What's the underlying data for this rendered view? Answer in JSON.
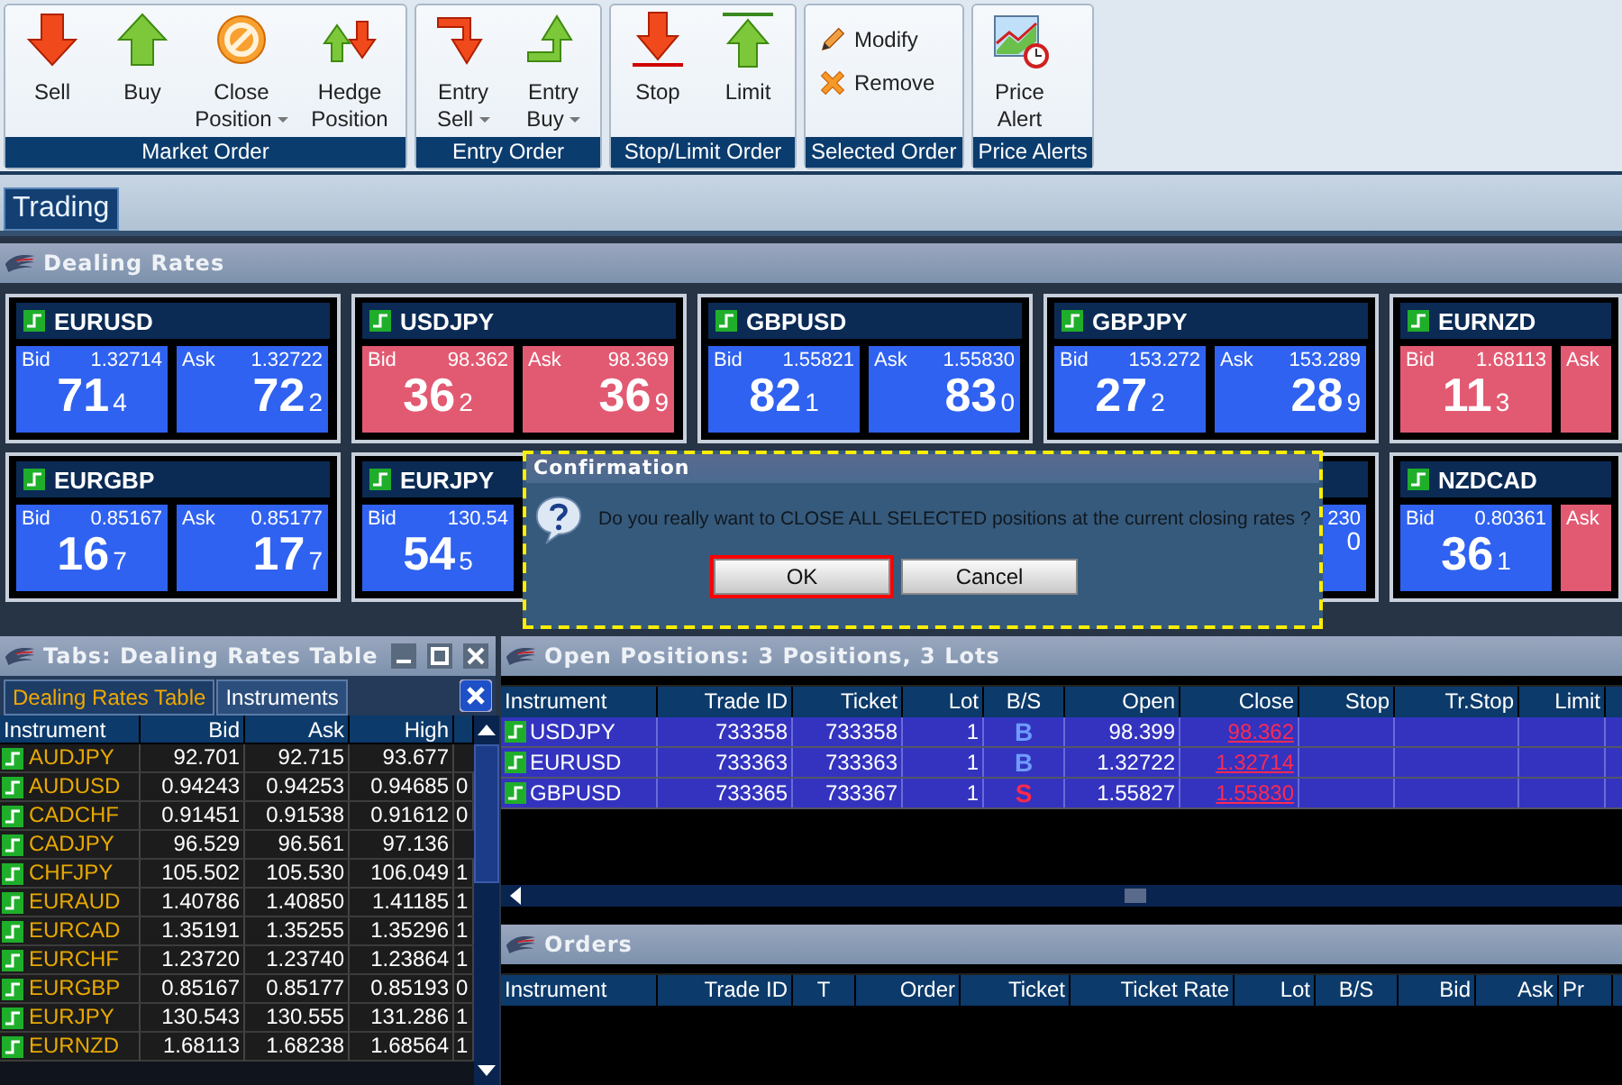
{
  "ribbon": {
    "groups": [
      {
        "label": "Market Order",
        "buttons": [
          {
            "label": "Sell",
            "kind": "large",
            "dropdown": false
          },
          {
            "label": "Buy",
            "kind": "large",
            "dropdown": false
          },
          {
            "label": "Close Position",
            "kind": "large",
            "dropdown": true
          },
          {
            "label": "Hedge Position",
            "kind": "large",
            "dropdown": false
          }
        ]
      },
      {
        "label": "Entry Order",
        "buttons": [
          {
            "label": "Entry Sell",
            "kind": "large",
            "dropdown": true
          },
          {
            "label": "Entry Buy",
            "kind": "large",
            "dropdown": true
          }
        ]
      },
      {
        "label": "Stop/Limit Order",
        "buttons": [
          {
            "label": "Stop",
            "kind": "large",
            "dropdown": false
          },
          {
            "label": "Limit",
            "kind": "large",
            "dropdown": false
          }
        ]
      },
      {
        "label": "Selected Order",
        "buttons": [
          {
            "label": "Modify",
            "kind": "small",
            "dropdown": false
          },
          {
            "label": "Remove",
            "kind": "small",
            "dropdown": false
          }
        ]
      },
      {
        "label": "Price Alerts",
        "buttons": [
          {
            "label": "Price Alert",
            "kind": "large",
            "dropdown": false
          }
        ]
      }
    ]
  },
  "main_tabs": [
    {
      "label": "Trading",
      "selected": true
    }
  ],
  "dealing_rates": {
    "title": "Dealing Rates",
    "rows": [
      [
        {
          "pair": "EURUSD",
          "bid": {
            "label": "Bid",
            "price": "1.32714",
            "big": "71",
            "small": "4",
            "color": "#2f62f0"
          },
          "ask": {
            "label": "Ask",
            "price": "1.32722",
            "big": "72",
            "small": "2",
            "color": "#2f62f0"
          }
        },
        {
          "pair": "USDJPY",
          "bid": {
            "label": "Bid",
            "price": "98.362",
            "big": "36",
            "small": "2",
            "color": "#e25a72"
          },
          "ask": {
            "label": "Ask",
            "price": "98.369",
            "big": "36",
            "small": "9",
            "color": "#e25a72"
          }
        },
        {
          "pair": "GBPUSD",
          "bid": {
            "label": "Bid",
            "price": "1.55821",
            "big": "82",
            "small": "1",
            "color": "#2f62f0"
          },
          "ask": {
            "label": "Ask",
            "price": "1.55830",
            "big": "83",
            "small": "0",
            "color": "#2f62f0"
          }
        },
        {
          "pair": "GBPJPY",
          "bid": {
            "label": "Bid",
            "price": "153.272",
            "big": "27",
            "small": "2",
            "color": "#2f62f0"
          },
          "ask": {
            "label": "Ask",
            "price": "153.289",
            "big": "28",
            "small": "9",
            "color": "#2f62f0"
          }
        },
        {
          "pair": "EURNZD",
          "bid": {
            "label": "Bid",
            "price": "1.68113",
            "big": "11",
            "small": "3",
            "color": "#e25a72"
          },
          "ask": {
            "label": "Ask",
            "color": "#e25a72"
          }
        }
      ],
      [
        {
          "pair": "EURGBP",
          "bid": {
            "label": "Bid",
            "price": "0.85167",
            "big": "16",
            "small": "7",
            "color": "#2f62f0"
          },
          "ask": {
            "label": "Ask",
            "price": "0.85177",
            "big": "17",
            "small": "7",
            "color": "#2f62f0"
          }
        },
        {
          "pair": "EURJPY",
          "bid": {
            "label": "Bid",
            "price": "130.54",
            "big": "54",
            "small": "5",
            "color": "#2f62f0"
          }
        },
        {},
        {
          "ask": {
            "price": "230",
            "small": "0",
            "color": "#2f62f0"
          }
        },
        {
          "pair": "NZDCAD",
          "bid": {
            "label": "Bid",
            "price": "0.80361",
            "big": "36",
            "small": "1",
            "color": "#2f62f0"
          },
          "ask": {
            "label": "Ask",
            "color": "#e25a72"
          }
        }
      ]
    ]
  },
  "dialog": {
    "title": "Confirmation",
    "message": "Do you really want to CLOSE ALL SELECTED positions at the current closing rates ?",
    "buttons": [
      {
        "label": "OK",
        "selected": true
      },
      {
        "label": "Cancel",
        "selected": false
      }
    ]
  },
  "rates_panel": {
    "title": "Tabs: Dealing Rates Table",
    "tabs": [
      {
        "label": "Dealing Rates Table",
        "selected": true
      },
      {
        "label": "Instruments",
        "selected": false
      }
    ],
    "columns": [
      "Instrument",
      "Bid",
      "Ask",
      "High"
    ],
    "rows": [
      [
        "AUDJPY",
        "92.701",
        "92.715",
        "93.677"
      ],
      [
        "AUDUSD",
        "0.94243",
        "0.94253",
        "0.94685",
        "0"
      ],
      [
        "CADCHF",
        "0.91451",
        "0.91538",
        "0.91612",
        "0"
      ],
      [
        "CADJPY",
        "96.529",
        "96.561",
        "97.136"
      ],
      [
        "CHFJPY",
        "105.502",
        "105.530",
        "106.049",
        "1"
      ],
      [
        "EURAUD",
        "1.40786",
        "1.40850",
        "1.41185",
        "1"
      ],
      [
        "EURCAD",
        "1.35191",
        "1.35255",
        "1.35296",
        "1"
      ],
      [
        "EURCHF",
        "1.23720",
        "1.23740",
        "1.23864",
        "1"
      ],
      [
        "EURGBP",
        "0.85167",
        "0.85177",
        "0.85193",
        "0"
      ],
      [
        "EURJPY",
        "130.543",
        "130.555",
        "131.286",
        "1"
      ],
      [
        "EURNZD",
        "1.68113",
        "1.68238",
        "1.68564",
        "1"
      ]
    ]
  },
  "open_positions": {
    "title": "Open Positions: 3 Positions, 3 Lots",
    "columns": [
      "Instrument",
      "Trade ID",
      "Ticket",
      "Lot",
      "B/S",
      "Open",
      "Close",
      "Stop",
      "Tr.Stop",
      "Limit"
    ],
    "rows": [
      {
        "selected": true,
        "instrument": "USDJPY",
        "trade_id": "733358",
        "ticket": "733358",
        "lot": "1",
        "bs": {
          "text": "B",
          "color": "#6f9cff"
        },
        "open": "98.399",
        "close": "98.362"
      },
      {
        "selected": true,
        "instrument": "EURUSD",
        "trade_id": "733363",
        "ticket": "733363",
        "lot": "1",
        "bs": {
          "text": "B",
          "color": "#6f9cff"
        },
        "open": "1.32722",
        "close": "1.32714"
      },
      {
        "selected": true,
        "instrument": "GBPUSD",
        "trade_id": "733365",
        "ticket": "733367",
        "lot": "1",
        "bs": {
          "text": "S",
          "color": "#ff2a4a"
        },
        "open": "1.55827",
        "close": "1.55830"
      }
    ]
  },
  "orders": {
    "title": "Orders",
    "columns": [
      "Instrument",
      "Trade ID",
      "T",
      "Order",
      "Ticket",
      "Ticket Rate",
      "Lot",
      "B/S",
      "Bid",
      "Ask",
      "Pr"
    ]
  }
}
